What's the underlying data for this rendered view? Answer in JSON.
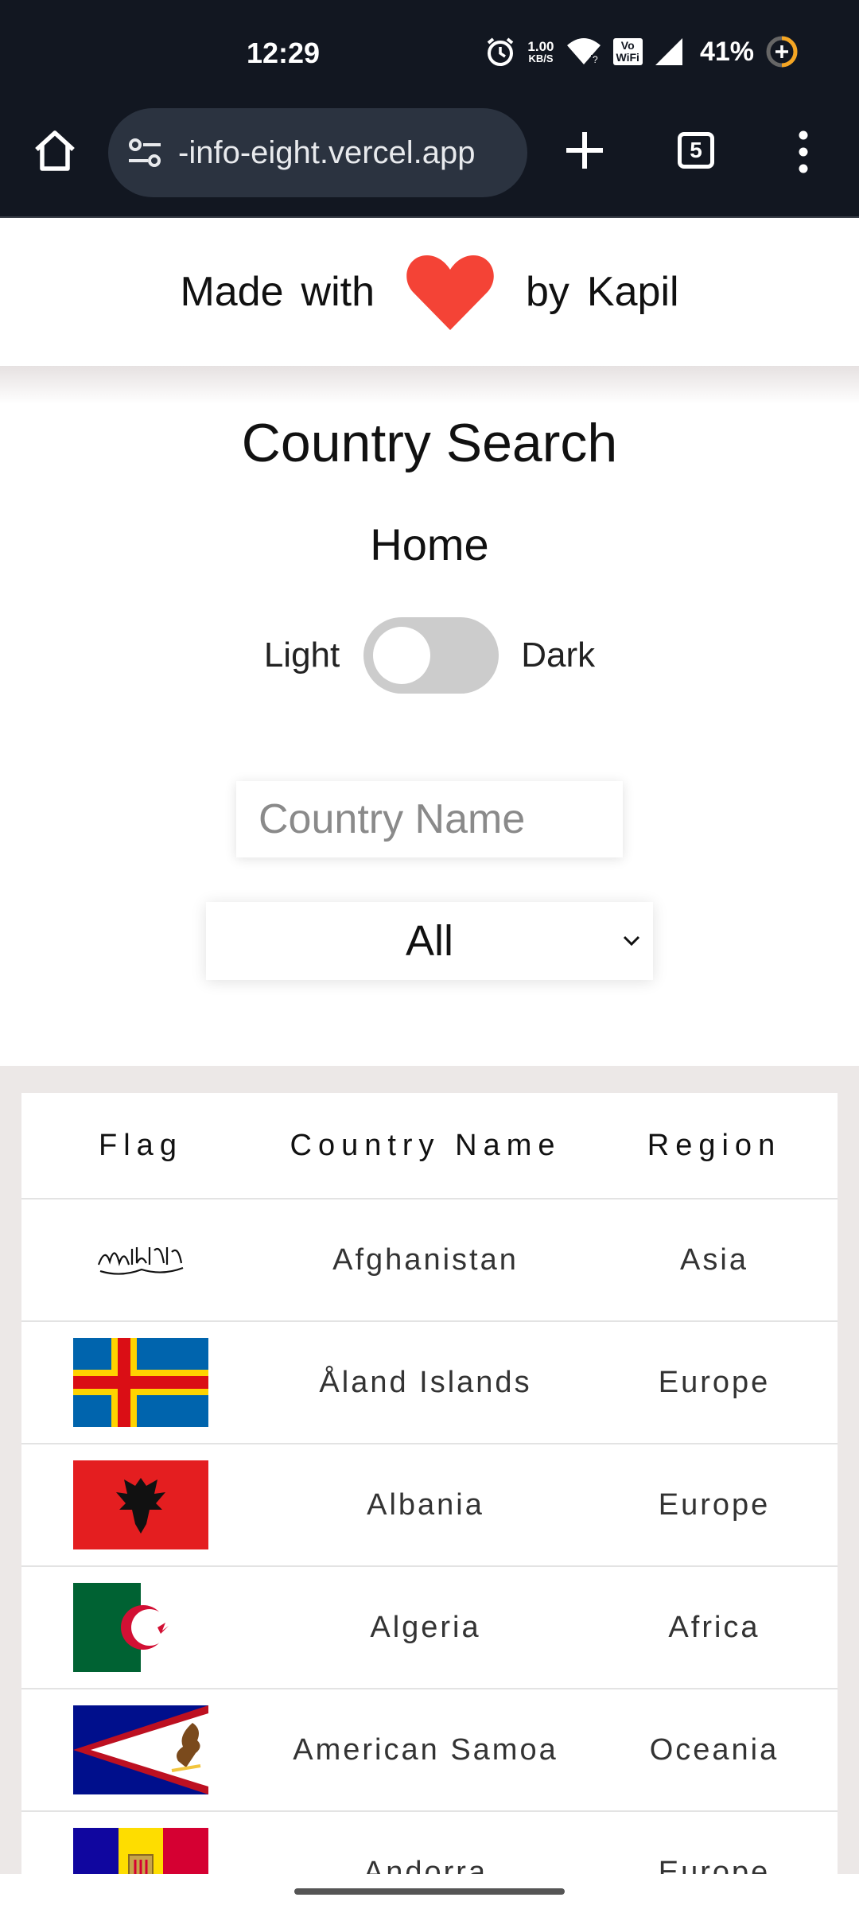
{
  "status_bar": {
    "time": "12:29",
    "net_speed_value": "1.00",
    "net_speed_unit": "KB/S",
    "vowifi_top": "Vo",
    "vowifi_bottom": "WiFi",
    "battery": "41%",
    "icons": [
      "alarm-icon",
      "wifi-icon",
      "signal-icon",
      "battery-saver-icon"
    ]
  },
  "browser": {
    "url": "-info-eight.vercel.app",
    "tab_count": "5",
    "icons": [
      "home-icon",
      "site-settings-icon",
      "new-tab-icon",
      "menu-icon"
    ]
  },
  "header": {
    "made": "Made",
    "with": "with",
    "by": "by",
    "author": "Kapil",
    "heart_color": "#f44336"
  },
  "page": {
    "title": "Country Search",
    "nav_home": "Home",
    "theme_light": "Light",
    "theme_dark": "Dark",
    "theme_is_dark": false
  },
  "search": {
    "placeholder": "Country Name",
    "value": ""
  },
  "region_filter": {
    "selected": "All"
  },
  "table": {
    "headers": {
      "flag": "Flag",
      "name": "Country Name",
      "region": "Region"
    },
    "rows": [
      {
        "flag": "afghanistan-flag",
        "name": "Afghanistan",
        "region": "Asia"
      },
      {
        "flag": "aland-islands-flag",
        "name": "Åland Islands",
        "region": "Europe"
      },
      {
        "flag": "albania-flag",
        "name": "Albania",
        "region": "Europe"
      },
      {
        "flag": "algeria-flag",
        "name": "Algeria",
        "region": "Africa"
      },
      {
        "flag": "american-samoa-flag",
        "name": "American Samoa",
        "region": "Oceania"
      },
      {
        "flag": "andorra-flag",
        "name": "Andorra",
        "region": "Europe"
      }
    ]
  }
}
